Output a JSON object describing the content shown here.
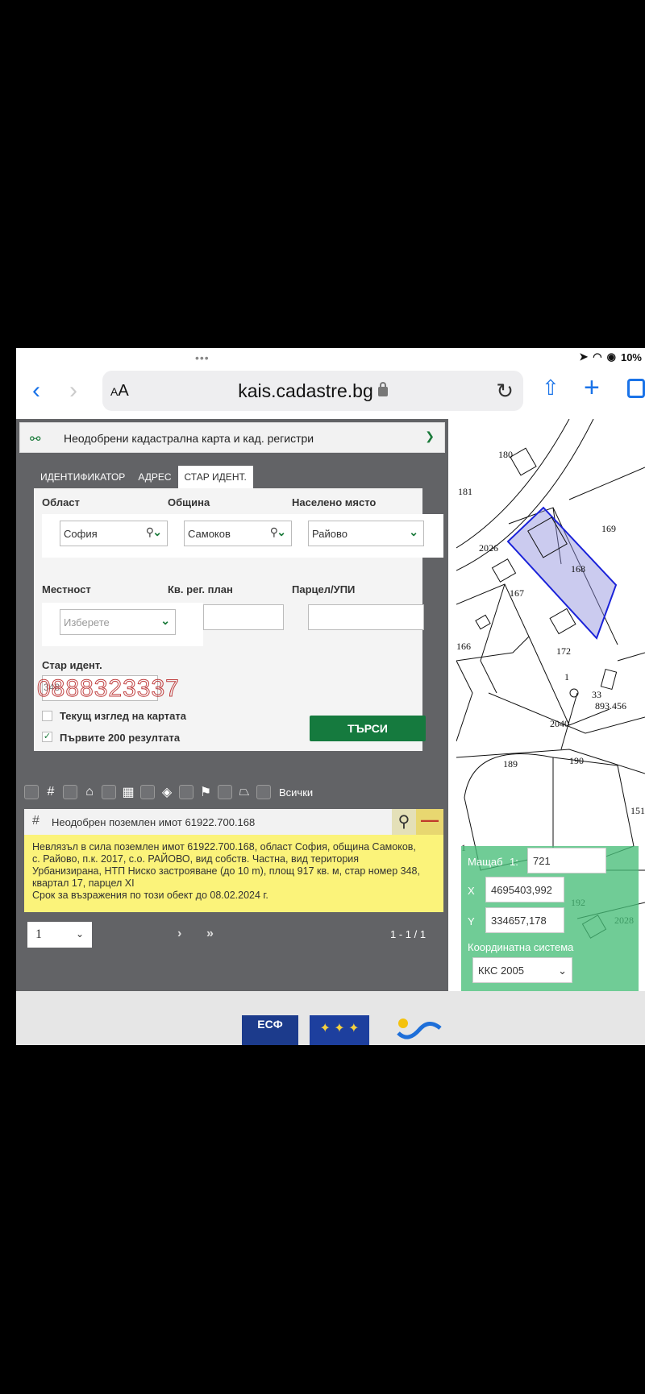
{
  "status": {
    "dots": "•••",
    "battery": "10%"
  },
  "browser": {
    "aa_small": "A",
    "aa_large": "A",
    "url": "kais.cadastre.bg"
  },
  "panel": {
    "title": "Неодобрени кадастрална карта и кад. регистри",
    "tabs": [
      "ИДЕНТИФИКАТОР",
      "АДРЕС",
      "СТАР ИДЕНТ."
    ],
    "labels": {
      "oblast": "Област",
      "obshtina": "Община",
      "naseleno": "Населено място",
      "mestnost": "Местност",
      "kvplan": "Кв. рег. план",
      "parcel": "Парцел/УПИ",
      "oldid": "Стар идент."
    },
    "values": {
      "oblast": "София",
      "obshtina": "Самоков",
      "naseleno": "Райово",
      "mestnost_placeholder": "Изберете",
      "oldid": "348"
    },
    "overlay_phone": "0888323337",
    "checks": {
      "current_view": "Текущ изглед на картата",
      "first200": "Първите 200 резултата"
    },
    "search_button": "ТЪРСИ"
  },
  "toolbar": {
    "all_label": "Всички"
  },
  "result": {
    "title": "Неодобрен поземлен имот 61922.700.168",
    "info_lines": [
      "Невлязъл в сила поземлен имот 61922.700.168, област София, община Самоков,",
      "с. Райово, п.к. 2017, с.о. РАЙОВО, вид собств. Частна, вид територия",
      "Урбанизирана, НТП Ниско застрояване (до 10 m), площ 917 кв. м, стар номер 348,",
      "квартал 17, парцел XI",
      "Срок за възражения по този обект до 08.02.2024 г."
    ]
  },
  "pager": {
    "page": "1",
    "count": "1 - 1 / 1"
  },
  "footer": {
    "esf": "ЕСФ"
  },
  "map": {
    "parcel_numbers": [
      "180",
      "181",
      "169",
      "2026",
      "168",
      "167",
      "166",
      "172",
      "1",
      "33",
      "893.456",
      "2040",
      "189",
      "190",
      "151",
      "1",
      "192",
      "2028"
    ],
    "scale_label": "Мащаб",
    "scale_prefix": "1:",
    "scale": "721",
    "x_label": "X",
    "x_value": "4695403,992",
    "y_label": "Y",
    "y_value": "334657,178",
    "coord_label": "Координатна система",
    "coord_value": "ККС 2005"
  },
  "colors": {
    "accent_green": "#157a3e",
    "highlight_yellow": "#fbf37a",
    "parcel_blue": "#1a22d9"
  }
}
